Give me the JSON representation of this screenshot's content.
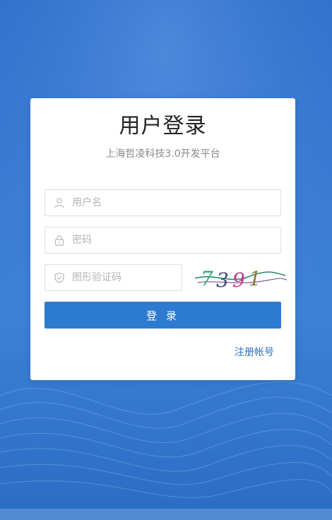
{
  "login": {
    "title": "用户登录",
    "subtitle": "上海哲凌科技3.0开发平台",
    "username": {
      "placeholder": "用户名",
      "value": ""
    },
    "password": {
      "placeholder": "密码",
      "value": ""
    },
    "captcha": {
      "placeholder": "图形验证码",
      "value": "",
      "image_text": "7391"
    },
    "submit_label": "登 录",
    "register_link": "注册帐号"
  },
  "colors": {
    "background": "#3a7ad4",
    "card": "#ffffff",
    "primary_button": "#2d7bd0",
    "link": "#2d6fc4",
    "border": "#dcdfe6"
  },
  "icons": {
    "username": "user-icon",
    "password": "lock-icon",
    "captcha": "shield-check-icon"
  }
}
